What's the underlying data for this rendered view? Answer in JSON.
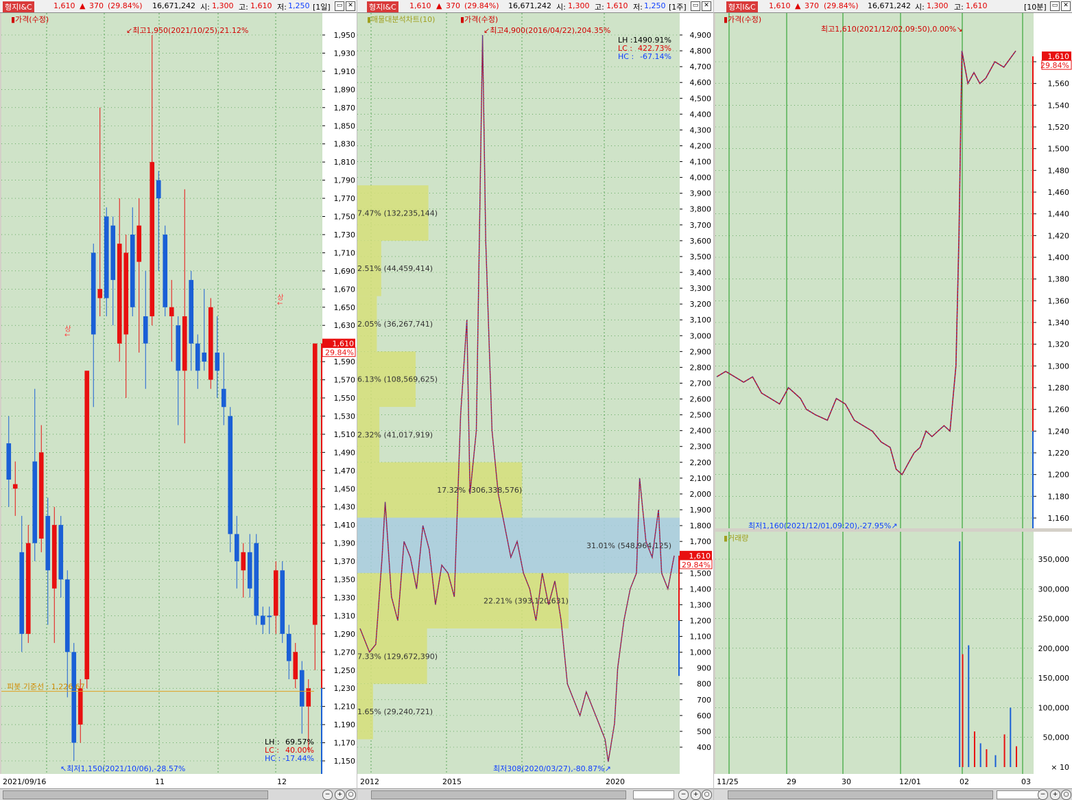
{
  "panels": [
    {
      "header": {
        "name": "형지I&C",
        "price": "1,610",
        "change": "370",
        "rate": "(29.84%)",
        "volume": "16,671,242",
        "open_label": "시:",
        "open": "1,300",
        "high_label": "고:",
        "high": "1,610",
        "low_label": "저:",
        "low": "1,250",
        "period": "[1일]"
      },
      "indicator": "가격(수정)",
      "max_note": "최고1,950(2021/10/25),21.12%",
      "min_note": "최저1,150(2021/10/06),-28.57%",
      "ref_line": "피봇 기준선 : 1,226.67",
      "upper_marks": [
        "상",
        "상"
      ],
      "price_tag": "1,610",
      "rate_tag": "29.84%",
      "stats": [
        {
          "label": "LH :",
          "value": "69.57%"
        },
        {
          "label": "LC :",
          "value": "40.00%"
        },
        {
          "label": "HC :",
          "value": "-17.44%"
        }
      ],
      "x_labels": [
        "2021/09/16",
        "11",
        "12"
      ],
      "y_ticks": [
        "1,950",
        "1,930",
        "1,910",
        "1,890",
        "1,870",
        "1,850",
        "1,830",
        "1,810",
        "1,790",
        "1,770",
        "1,750",
        "1,730",
        "1,710",
        "1,690",
        "1,670",
        "1,650",
        "1,630",
        "1,610",
        "1,590",
        "1,570",
        "1,550",
        "1,530",
        "1,510",
        "1,490",
        "1,470",
        "1,450",
        "1,430",
        "1,410",
        "1,390",
        "1,370",
        "1,350",
        "1,330",
        "1,310",
        "1,290",
        "1,270",
        "1,250",
        "1,230",
        "1,210",
        "1,190",
        "1,170",
        "1,150"
      ]
    },
    {
      "header": {
        "name": "형지I&C",
        "price": "1,610",
        "change": "370",
        "rate": "(29.84%)",
        "volume": "16,671,242",
        "open_label": "시:",
        "open": "1,300",
        "high_label": "고:",
        "high": "1,610",
        "low_label": "저:",
        "low": "1,250",
        "period": "[1주]"
      },
      "indicator": "가격(수정)",
      "indicator2": "매물대분석차트(10)",
      "max_note": "최고4,900(2016/04/22),204.35%",
      "min_note": "최저308(2020/03/27),-80.87%",
      "price_tag": "1,610",
      "rate_tag": "29.84%",
      "stats": [
        {
          "label": "LH :",
          "value": "1490.91%"
        },
        {
          "label": "LC :",
          "value": "422.73%"
        },
        {
          "label": "HC :",
          "value": "-67.14%"
        }
      ],
      "volume_profile": [
        {
          "label": "7.47% (132,235,144)",
          "pct": 7.47,
          "lo": 3600,
          "hi": 3950
        },
        {
          "label": "2.51% (44,459,414)",
          "pct": 2.51,
          "lo": 3250,
          "hi": 3600
        },
        {
          "label": "2.05% (36,267,741)",
          "pct": 2.05,
          "lo": 2900,
          "hi": 3250
        },
        {
          "label": "6.13% (108,569,625)",
          "pct": 6.13,
          "lo": 2550,
          "hi": 2900
        },
        {
          "label": "2.32% (41,017,919)",
          "pct": 2.32,
          "lo": 2200,
          "hi": 2550
        },
        {
          "label": "17.32% (306,338,576)",
          "pct": 17.32,
          "lo": 1850,
          "hi": 2200
        },
        {
          "label": "31.01% (548,964,125)",
          "pct": 31.01,
          "lo": 1500,
          "hi": 1850
        },
        {
          "label": "22.21% (393,120,631)",
          "pct": 22.21,
          "lo": 1150,
          "hi": 1500
        },
        {
          "label": "7.33% (129,672,390)",
          "pct": 7.33,
          "lo": 800,
          "hi": 1150
        },
        {
          "label": "1.65% (29,240,721)",
          "pct": 1.65,
          "lo": 450,
          "hi": 800
        }
      ],
      "x_labels": [
        "2012",
        "2015",
        "2020"
      ],
      "y_ticks": [
        "4,900",
        "4,800",
        "4,700",
        "4,600",
        "4,500",
        "4,400",
        "4,300",
        "4,200",
        "4,100",
        "4,000",
        "3,900",
        "3,800",
        "3,700",
        "3,600",
        "3,500",
        "3,400",
        "3,300",
        "3,200",
        "3,100",
        "3,000",
        "2,900",
        "2,800",
        "2,700",
        "2,600",
        "2,500",
        "2,400",
        "2,300",
        "2,200",
        "2,100",
        "2,000",
        "1,900",
        "1,800",
        "1,700",
        "1,600",
        "1,500",
        "1,400",
        "1,300",
        "1,200",
        "1,100",
        "1,000",
        "900",
        "800",
        "700",
        "600",
        "500",
        "400"
      ]
    },
    {
      "header": {
        "name": "형지I&C",
        "price": "1,610",
        "change": "370",
        "rate": "(29.84%)",
        "volume": "16,671,242",
        "open_label": "시:",
        "open": "1,300",
        "high_label": "고:",
        "high": "1,610",
        "period": "[10분]"
      },
      "indicator": "가격(수정)",
      "indicator_vol": "거래량",
      "max_note": "최고1,610(2021/12/02,09:50),0.00%",
      "min_note": "최저1,160(2021/12/01,09:20),-27.95%",
      "price_tag": "1,610",
      "rate_tag": "29.84%",
      "x_labels": [
        "11/25",
        "29",
        "30",
        "12/01",
        "02",
        "03"
      ],
      "y_ticks": [
        "1,580",
        "1,560",
        "1,540",
        "1,520",
        "1,500",
        "1,480",
        "1,460",
        "1,440",
        "1,420",
        "1,400",
        "1,380",
        "1,360",
        "1,340",
        "1,320",
        "1,300",
        "1,280",
        "1,260",
        "1,240",
        "1,220",
        "1,200",
        "1,180",
        "1,160"
      ],
      "vol_ticks": [
        "350,000",
        "300,000",
        "250,000",
        "200,000",
        "150,000",
        "100,000",
        "50,000"
      ],
      "vol_unit": "× 10"
    }
  ],
  "colors": {
    "up": "#e81010",
    "down": "#1a5fd6",
    "bg": "#cfe3c8",
    "grid": "#2a8a2a",
    "vp_yellow": "#d6df7a",
    "vp_blue": "#a9cde0"
  },
  "chart_data": [
    {
      "type": "candlestick",
      "title": "형지I&C [1일]",
      "ylim": [
        1140,
        1960
      ],
      "high": {
        "value": 1950,
        "date": "2021/10/25"
      },
      "low": {
        "value": 1150,
        "date": "2021/10/06"
      },
      "pivot": 1226.67,
      "series": [
        {
          "o": 1500,
          "c": 1460,
          "h": 1530,
          "l": 1430,
          "up": false
        },
        {
          "o": 1450,
          "c": 1455,
          "h": 1480,
          "l": 1420,
          "up": true
        },
        {
          "o": 1380,
          "c": 1290,
          "h": 1420,
          "l": 1270,
          "up": false
        },
        {
          "o": 1290,
          "c": 1390,
          "h": 1410,
          "l": 1280,
          "up": true
        },
        {
          "o": 1480,
          "c": 1390,
          "h": 1560,
          "l": 1370,
          "up": false
        },
        {
          "o": 1395,
          "c": 1490,
          "h": 1520,
          "l": 1380,
          "up": true
        },
        {
          "o": 1420,
          "c": 1360,
          "h": 1440,
          "l": 1300,
          "up": false
        },
        {
          "o": 1340,
          "c": 1410,
          "h": 1430,
          "l": 1280,
          "up": true
        },
        {
          "o": 1410,
          "c": 1350,
          "h": 1420,
          "l": 1330,
          "up": false
        },
        {
          "o": 1350,
          "c": 1270,
          "h": 1360,
          "l": 1220,
          "up": false
        },
        {
          "o": 1270,
          "c": 1170,
          "h": 1280,
          "l": 1150,
          "up": false
        },
        {
          "o": 1190,
          "c": 1230,
          "h": 1240,
          "l": 1170,
          "up": true
        },
        {
          "o": 1240,
          "c": 1580,
          "h": 1580,
          "l": 1230,
          "up": true
        },
        {
          "o": 1710,
          "c": 1620,
          "h": 1720,
          "l": 1540,
          "up": false
        },
        {
          "o": 1660,
          "c": 1670,
          "h": 1870,
          "l": 1640,
          "up": true
        },
        {
          "o": 1660,
          "c": 1750,
          "h": 1760,
          "l": 1640,
          "up": false
        },
        {
          "o": 1740,
          "c": 1680,
          "h": 1750,
          "l": 1630,
          "up": false
        },
        {
          "o": 1610,
          "c": 1720,
          "h": 1770,
          "l": 1590,
          "up": true
        },
        {
          "o": 1620,
          "c": 1710,
          "h": 1730,
          "l": 1550,
          "up": true
        },
        {
          "o": 1730,
          "c": 1650,
          "h": 1760,
          "l": 1640,
          "up": false
        },
        {
          "o": 1700,
          "c": 1740,
          "h": 1770,
          "l": 1600,
          "up": true
        },
        {
          "o": 1640,
          "c": 1610,
          "h": 1690,
          "l": 1560,
          "up": false
        },
        {
          "o": 1640,
          "c": 1810,
          "h": 1950,
          "l": 1630,
          "up": true
        },
        {
          "o": 1790,
          "c": 1770,
          "h": 1800,
          "l": 1690,
          "up": false
        },
        {
          "o": 1730,
          "c": 1650,
          "h": 1740,
          "l": 1640,
          "up": false
        },
        {
          "o": 1640,
          "c": 1650,
          "h": 1680,
          "l": 1590,
          "up": true
        },
        {
          "o": 1630,
          "c": 1580,
          "h": 1640,
          "l": 1520,
          "up": false
        },
        {
          "o": 1580,
          "c": 1640,
          "h": 1780,
          "l": 1500,
          "up": true
        },
        {
          "o": 1680,
          "c": 1610,
          "h": 1690,
          "l": 1580,
          "up": false
        },
        {
          "o": 1610,
          "c": 1580,
          "h": 1620,
          "l": 1560,
          "up": false
        },
        {
          "o": 1590,
          "c": 1600,
          "h": 1670,
          "l": 1580,
          "up": false
        },
        {
          "o": 1570,
          "c": 1650,
          "h": 1660,
          "l": 1560,
          "up": true
        },
        {
          "o": 1600,
          "c": 1580,
          "h": 1640,
          "l": 1550,
          "up": false
        },
        {
          "o": 1560,
          "c": 1540,
          "h": 1600,
          "l": 1520,
          "up": false
        },
        {
          "o": 1530,
          "c": 1400,
          "h": 1540,
          "l": 1380,
          "up": false
        },
        {
          "o": 1400,
          "c": 1370,
          "h": 1420,
          "l": 1340,
          "up": false
        },
        {
          "o": 1360,
          "c": 1380,
          "h": 1390,
          "l": 1330,
          "up": true
        },
        {
          "o": 1380,
          "c": 1340,
          "h": 1400,
          "l": 1330,
          "up": false
        },
        {
          "o": 1390,
          "c": 1310,
          "h": 1400,
          "l": 1300,
          "up": false
        },
        {
          "o": 1300,
          "c": 1310,
          "h": 1320,
          "l": 1290,
          "up": false
        },
        {
          "o": 1310,
          "c": 1310,
          "h": 1320,
          "l": 1290,
          "up": false
        },
        {
          "o": 1310,
          "c": 1360,
          "h": 1370,
          "l": 1290,
          "up": true
        },
        {
          "o": 1360,
          "c": 1290,
          "h": 1370,
          "l": 1280,
          "up": false
        },
        {
          "o": 1290,
          "c": 1260,
          "h": 1300,
          "l": 1240,
          "up": false
        },
        {
          "o": 1270,
          "c": 1240,
          "h": 1280,
          "l": 1230,
          "up": true
        },
        {
          "o": 1250,
          "c": 1210,
          "h": 1260,
          "l": 1180,
          "up": false
        },
        {
          "o": 1230,
          "c": 1210,
          "h": 1240,
          "l": 1160,
          "up": true
        },
        {
          "o": 1300,
          "c": 1610,
          "h": 1610,
          "l": 1250,
          "up": true
        }
      ]
    },
    {
      "type": "candlestick",
      "title": "형지I&C [1주]",
      "ylim": [
        300,
        4950
      ],
      "high": {
        "value": 4900,
        "date": "2016/04/22"
      },
      "low": {
        "value": 308,
        "date": "2020/03/27"
      },
      "series": [
        {
          "x": 0.0,
          "v": 1150
        },
        {
          "x": 0.03,
          "v": 1000
        },
        {
          "x": 0.05,
          "v": 1050
        },
        {
          "x": 0.07,
          "v": 1600
        },
        {
          "x": 0.08,
          "v": 1950
        },
        {
          "x": 0.1,
          "v": 1350
        },
        {
          "x": 0.12,
          "v": 1200
        },
        {
          "x": 0.14,
          "v": 1700
        },
        {
          "x": 0.16,
          "v": 1600
        },
        {
          "x": 0.18,
          "v": 1400
        },
        {
          "x": 0.2,
          "v": 1800
        },
        {
          "x": 0.22,
          "v": 1650
        },
        {
          "x": 0.24,
          "v": 1300
        },
        {
          "x": 0.26,
          "v": 1550
        },
        {
          "x": 0.28,
          "v": 1500
        },
        {
          "x": 0.3,
          "v": 1350
        },
        {
          "x": 0.32,
          "v": 2500
        },
        {
          "x": 0.34,
          "v": 3100
        },
        {
          "x": 0.35,
          "v": 2000
        },
        {
          "x": 0.37,
          "v": 2400
        },
        {
          "x": 0.39,
          "v": 4900
        },
        {
          "x": 0.4,
          "v": 3600
        },
        {
          "x": 0.42,
          "v": 2400
        },
        {
          "x": 0.44,
          "v": 2000
        },
        {
          "x": 0.46,
          "v": 1800
        },
        {
          "x": 0.48,
          "v": 1600
        },
        {
          "x": 0.5,
          "v": 1700
        },
        {
          "x": 0.52,
          "v": 1500
        },
        {
          "x": 0.54,
          "v": 1400
        },
        {
          "x": 0.56,
          "v": 1200
        },
        {
          "x": 0.58,
          "v": 1500
        },
        {
          "x": 0.6,
          "v": 1300
        },
        {
          "x": 0.62,
          "v": 1450
        },
        {
          "x": 0.64,
          "v": 1200
        },
        {
          "x": 0.65,
          "v": 1000
        },
        {
          "x": 0.66,
          "v": 800
        },
        {
          "x": 0.68,
          "v": 700
        },
        {
          "x": 0.7,
          "v": 600
        },
        {
          "x": 0.72,
          "v": 750
        },
        {
          "x": 0.74,
          "v": 650
        },
        {
          "x": 0.76,
          "v": 550
        },
        {
          "x": 0.78,
          "v": 450
        },
        {
          "x": 0.79,
          "v": 308
        },
        {
          "x": 0.81,
          "v": 550
        },
        {
          "x": 0.82,
          "v": 900
        },
        {
          "x": 0.84,
          "v": 1200
        },
        {
          "x": 0.86,
          "v": 1400
        },
        {
          "x": 0.88,
          "v": 1500
        },
        {
          "x": 0.89,
          "v": 2100
        },
        {
          "x": 0.91,
          "v": 1700
        },
        {
          "x": 0.93,
          "v": 1600
        },
        {
          "x": 0.95,
          "v": 1900
        },
        {
          "x": 0.96,
          "v": 1500
        },
        {
          "x": 0.98,
          "v": 1400
        },
        {
          "x": 1.0,
          "v": 1610
        }
      ]
    },
    {
      "type": "candlestick",
      "title": "형지I&C [10분]",
      "ylim": [
        1150,
        1600
      ],
      "high": {
        "value": 1610,
        "date": "2021/12/02,09:50"
      },
      "low": {
        "value": 1160,
        "date": "2021/12/01,09:20"
      },
      "series": [
        {
          "x": 0.0,
          "v": 1290
        },
        {
          "x": 0.03,
          "v": 1295
        },
        {
          "x": 0.06,
          "v": 1290
        },
        {
          "x": 0.09,
          "v": 1285
        },
        {
          "x": 0.12,
          "v": 1290
        },
        {
          "x": 0.15,
          "v": 1275
        },
        {
          "x": 0.18,
          "v": 1270
        },
        {
          "x": 0.21,
          "v": 1265
        },
        {
          "x": 0.24,
          "v": 1280
        },
        {
          "x": 0.26,
          "v": 1275
        },
        {
          "x": 0.28,
          "v": 1270
        },
        {
          "x": 0.3,
          "v": 1260
        },
        {
          "x": 0.33,
          "v": 1255
        },
        {
          "x": 0.37,
          "v": 1250
        },
        {
          "x": 0.4,
          "v": 1270
        },
        {
          "x": 0.43,
          "v": 1265
        },
        {
          "x": 0.46,
          "v": 1250
        },
        {
          "x": 0.49,
          "v": 1245
        },
        {
          "x": 0.52,
          "v": 1240
        },
        {
          "x": 0.55,
          "v": 1230
        },
        {
          "x": 0.58,
          "v": 1225
        },
        {
          "x": 0.6,
          "v": 1205
        },
        {
          "x": 0.62,
          "v": 1200
        },
        {
          "x": 0.64,
          "v": 1210
        },
        {
          "x": 0.66,
          "v": 1220
        },
        {
          "x": 0.68,
          "v": 1225
        },
        {
          "x": 0.7,
          "v": 1240
        },
        {
          "x": 0.72,
          "v": 1235
        },
        {
          "x": 0.74,
          "v": 1240
        },
        {
          "x": 0.76,
          "v": 1245
        },
        {
          "x": 0.78,
          "v": 1240
        },
        {
          "x": 0.8,
          "v": 1300
        },
        {
          "x": 0.81,
          "v": 1420
        },
        {
          "x": 0.82,
          "v": 1590
        },
        {
          "x": 0.84,
          "v": 1560
        },
        {
          "x": 0.86,
          "v": 1570
        },
        {
          "x": 0.88,
          "v": 1560
        },
        {
          "x": 0.9,
          "v": 1565
        },
        {
          "x": 0.93,
          "v": 1580
        },
        {
          "x": 0.96,
          "v": 1575
        },
        {
          "x": 1.0,
          "v": 1590
        }
      ],
      "volume": [
        {
          "x": 0.81,
          "v": 380000
        },
        {
          "x": 0.82,
          "v": 190000
        },
        {
          "x": 0.84,
          "v": 205000
        },
        {
          "x": 0.86,
          "v": 60000
        },
        {
          "x": 0.88,
          "v": 40000
        },
        {
          "x": 0.9,
          "v": 30000
        },
        {
          "x": 0.93,
          "v": 20000
        },
        {
          "x": 0.96,
          "v": 55000
        },
        {
          "x": 0.98,
          "v": 100000
        },
        {
          "x": 1.0,
          "v": 35000
        }
      ]
    }
  ]
}
